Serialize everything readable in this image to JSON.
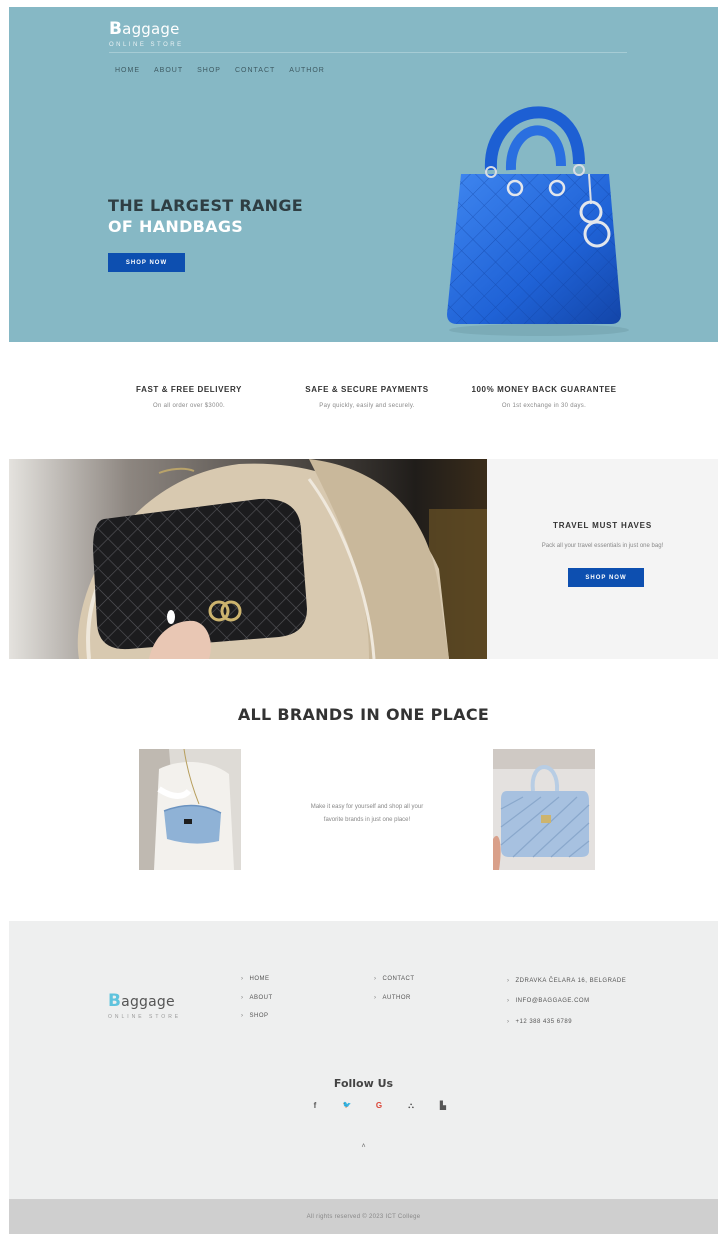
{
  "header": {
    "logo_initial": "B",
    "logo_rest": "aggage",
    "logo_tagline": "ONLINE STORE",
    "nav": [
      "HOME",
      "ABOUT",
      "SHOP",
      "CONTACT",
      "AUTHOR"
    ]
  },
  "hero": {
    "title_line1": "THE LARGEST RANGE",
    "title_line2": "OF HANDBAGS",
    "button": "SHOP NOW",
    "image": "blue-quilted-handbag"
  },
  "features": [
    {
      "title": "FAST & FREE DELIVERY",
      "text": "On all order over $3000."
    },
    {
      "title": "SAFE & SECURE PAYMENTS",
      "text": "Pay quickly, easily and securely."
    },
    {
      "title": "100% MONEY BACK GUARANTEE",
      "text": "On 1st exchange in 30 days."
    }
  ],
  "travel": {
    "image": "black-quilted-bag-on-shoulder",
    "title": "TRAVEL MUST HAVES",
    "text": "Pack all your travel essentials in just one bag!",
    "button": "SHOP NOW"
  },
  "brands": {
    "title": "ALL BRANDS IN ONE PLACE",
    "text_line1": "Make it easy for yourself and shop all your",
    "text_line2": "favorite brands in just one place!",
    "image_left": "light-blue-shoulder-bag",
    "image_right": "light-blue-chevron-handbag"
  },
  "footer": {
    "logo_initial": "B",
    "logo_rest": "aggage",
    "logo_tagline": "ONLINE STORE",
    "links_col1": [
      "HOME",
      "ABOUT",
      "SHOP"
    ],
    "links_col2": [
      "CONTACT",
      "AUTHOR"
    ],
    "contact": [
      "ZDRAVKA ČELARA 16, BELGRADE",
      "INFO@BAGGAGE.COM",
      "+12 388 435 6789"
    ],
    "follow_title": "Follow Us",
    "socials": [
      {
        "glyph": "f",
        "icon": "facebook-icon",
        "color": "#555555"
      },
      {
        "glyph": "🐦",
        "icon": "twitter-icon",
        "color": "#3a8fd8"
      },
      {
        "glyph": "G",
        "icon": "google-icon",
        "color": "#db4437"
      },
      {
        "glyph": "⛬",
        "icon": "sitemap-icon",
        "color": "#555555"
      },
      {
        "glyph": "▙",
        "icon": "document-icon",
        "color": "#555555"
      }
    ],
    "to_top": "˄",
    "copyright": "All rights reserved © 2023 ICT College"
  },
  "colors": {
    "hero_bg": "#86b8c5",
    "accent_button": "#0d4fb0",
    "footer_bg": "#eeefef",
    "bottom_bar": "#cfcfcf",
    "logo_footer_accent": "#5fc3dd"
  }
}
